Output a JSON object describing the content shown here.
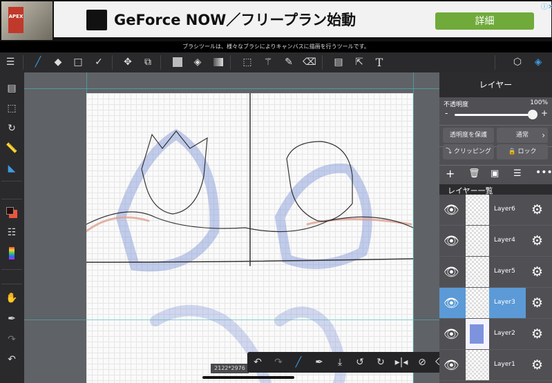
{
  "ad": {
    "brand_image_text": "APEX",
    "title": "GeForce NOW／フリープラン始動",
    "button_label": "詳細",
    "close_label": "ⓘ✕"
  },
  "hint_bar": "ブラシツールは、様々なブラシによりキャンバスに描画を行うツールです。",
  "toolbar": {
    "icons": [
      "menu-icon",
      "brush-icon",
      "eraser-icon",
      "shape-icon",
      "correction-icon",
      "move-icon",
      "transform-icon",
      "fill-color-icon",
      "bucket-icon",
      "gradient-icon",
      "select-rect-icon",
      "magic-wand-icon",
      "select-pen-icon",
      "select-eraser-icon",
      "frame-icon",
      "select-layer-icon",
      "text-icon",
      "material-icon",
      "layers-icon"
    ],
    "active_color": "#3d9be0"
  },
  "layer_panel": {
    "title": "レイヤー",
    "opacity_label": "不透明度",
    "opacity_value": "100%",
    "opacity": 100,
    "minus": "-",
    "plus": "+",
    "protect_alpha": "透明度を保護",
    "blend_mode": "通常",
    "clipping": "クリッピング",
    "lock": "ロック",
    "list_title": "レイヤー一覧",
    "layers": [
      {
        "name": "Layer6",
        "visible": true,
        "selected": false
      },
      {
        "name": "Layer4",
        "visible": true,
        "selected": false
      },
      {
        "name": "Layer5",
        "visible": true,
        "selected": false
      },
      {
        "name": "Layer3",
        "visible": true,
        "selected": true
      },
      {
        "name": "Layer2",
        "visible": true,
        "selected": false
      },
      {
        "name": "Layer1",
        "visible": true,
        "selected": false
      }
    ],
    "selected_color": "#5b9ad6"
  },
  "canvas": {
    "size_label": "2122*2976"
  }
}
